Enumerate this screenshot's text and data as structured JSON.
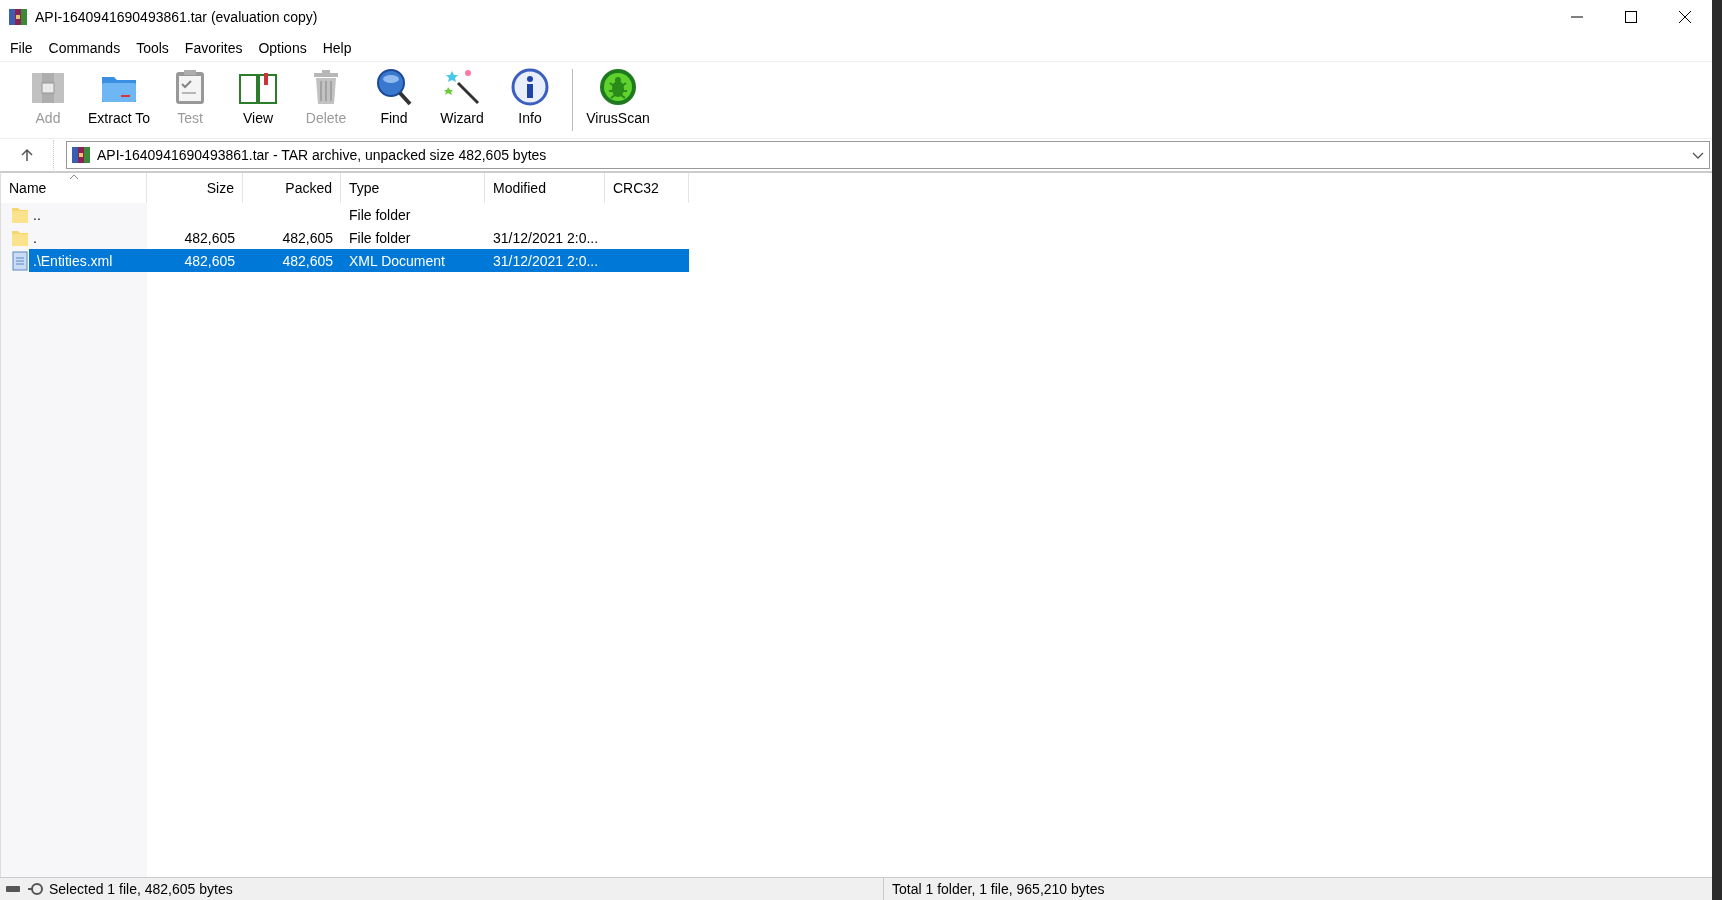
{
  "window": {
    "title": "API-1640941690493861.tar (evaluation copy)"
  },
  "menu": [
    "File",
    "Commands",
    "Tools",
    "Favorites",
    "Options",
    "Help"
  ],
  "toolbar": [
    {
      "label": "Add",
      "disabled": true
    },
    {
      "label": "Extract To",
      "disabled": false
    },
    {
      "label": "Test",
      "disabled": true
    },
    {
      "label": "View",
      "disabled": false
    },
    {
      "label": "Delete",
      "disabled": true
    },
    {
      "label": "Find",
      "disabled": false
    },
    {
      "label": "Wizard",
      "disabled": false
    },
    {
      "label": "Info",
      "disabled": false
    },
    {
      "label": "VirusScan",
      "disabled": false
    }
  ],
  "address": {
    "value": "API-1640941690493861.tar - TAR archive, unpacked size 482,605 bytes"
  },
  "table": {
    "columns": [
      {
        "label": "Name",
        "sorted": true
      },
      {
        "label": "Size",
        "sorted": false
      },
      {
        "label": "Packed",
        "sorted": false
      },
      {
        "label": "Type",
        "sorted": false
      },
      {
        "label": "Modified",
        "sorted": false
      },
      {
        "label": "CRC32",
        "sorted": false
      }
    ],
    "rows": [
      {
        "kind": "folder",
        "name": "..",
        "type": "File folder",
        "selected": false
      },
      {
        "kind": "folder",
        "name": ".",
        "size": "482,605",
        "packed": "482,605",
        "type": "File folder",
        "modified": "31/12/2021 2:0...",
        "selected": false
      },
      {
        "kind": "file",
        "name": ".\\Entities.xml",
        "size": "482,605",
        "packed": "482,605",
        "type": "XML Document",
        "modified": "31/12/2021 2:0...",
        "selected": true
      }
    ]
  },
  "status_bar": {
    "left": "Selected 1 file, 482,605 bytes",
    "right": "Total 1 folder, 1 file, 965,210 bytes"
  }
}
